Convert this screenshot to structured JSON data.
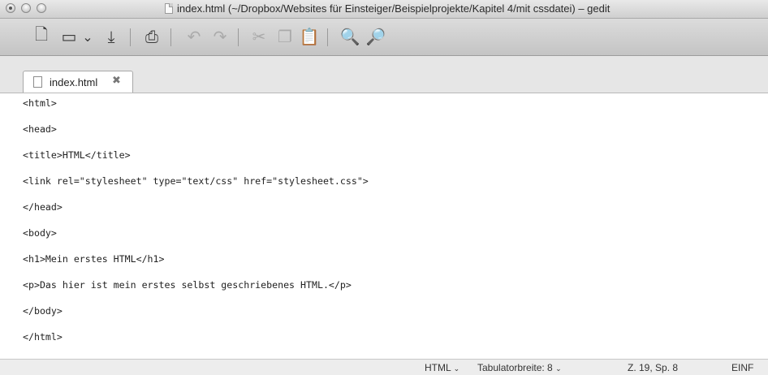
{
  "window": {
    "title": "index.html (~/Dropbox/Websites für Einsteiger/Beispielprojekte/Kapitel 4/mit cssdatei) – gedit"
  },
  "toolbar": {
    "buttons": [
      {
        "name": "new-document",
        "icon": "new-document-icon",
        "glyph": "🗋"
      },
      {
        "name": "open",
        "icon": "open-folder-icon",
        "glyph": "▭"
      },
      {
        "name": "open-menu",
        "icon": "chevron-down-icon",
        "glyph": "⌄"
      },
      {
        "name": "save",
        "icon": "save-icon",
        "glyph": "⤓"
      },
      {
        "name": "print",
        "icon": "print-icon",
        "glyph": "⎙"
      },
      {
        "name": "undo",
        "icon": "undo-icon",
        "glyph": "↶"
      },
      {
        "name": "redo",
        "icon": "redo-icon",
        "glyph": "↷"
      },
      {
        "name": "cut",
        "icon": "scissors-icon",
        "glyph": "✂"
      },
      {
        "name": "copy",
        "icon": "copy-icon",
        "glyph": "❐"
      },
      {
        "name": "paste",
        "icon": "clipboard-icon",
        "glyph": "📋"
      },
      {
        "name": "find",
        "icon": "search-icon",
        "glyph": "🔍"
      },
      {
        "name": "find-replace",
        "icon": "search-replace-icon",
        "glyph": "🔎"
      }
    ]
  },
  "tab": {
    "label": "index.html",
    "close_glyph": "✖"
  },
  "editor": {
    "lines": [
      "<html>",
      "<head>",
      "<title>HTML</title>",
      "<link rel=\"stylesheet\" type=\"text/css\" href=\"stylesheet.css\">",
      "</head>",
      "<body>",
      "<h1>Mein erstes HTML</h1>",
      "<p>Das hier ist mein erstes selbst geschriebenes HTML.</p>",
      "</body>",
      "</html>"
    ]
  },
  "statusbar": {
    "language": "HTML",
    "tab_width_label": "Tabulatorbreite: 8",
    "cursor_position": "Z. 19, Sp. 8",
    "insert_mode": "EINF",
    "chevron": "⌄"
  }
}
